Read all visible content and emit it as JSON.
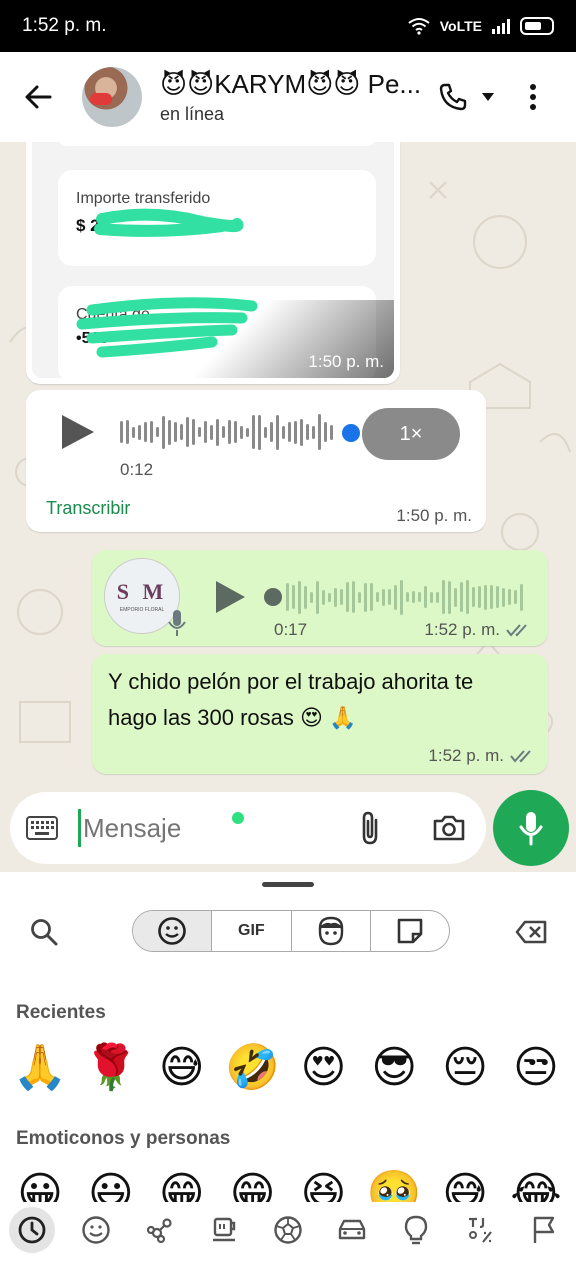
{
  "status_bar": {
    "time": "1:52 p. m.",
    "network": "VoLTE"
  },
  "header": {
    "name": "😈😈KARYM😈😈 Pe...",
    "status": "en línea"
  },
  "messages": {
    "transfer": {
      "field1_label": "Importe transferido",
      "field1_value": "$ 2,",
      "field2_label": "Cuenta de",
      "field2_value": "•518",
      "time": "1:50 p. m."
    },
    "audio_in": {
      "speed": "1×",
      "duration": "0:12",
      "transcribe": "Transcribir",
      "time": "1:50 p. m."
    },
    "audio_out": {
      "avatar_text": "S M",
      "avatar_sub": "EMPORIO FLORAL",
      "duration": "0:17",
      "time": "1:52 p. m."
    },
    "text_out": {
      "text": "Y chido pelón por el trabajo ahorita te hago las 300 rosas 😍 🙏",
      "time": "1:52 p. m."
    }
  },
  "input": {
    "placeholder": "Mensaje"
  },
  "emoji_panel": {
    "tabs": {
      "gif": "GIF"
    },
    "recent_label": "Recientes",
    "recent": [
      "🙏",
      "🌹",
      "😅",
      "🤣",
      "😍",
      "😎",
      "😔",
      "😒"
    ],
    "people_label": "Emoticonos y personas",
    "people": [
      "😀",
      "😃",
      "😁",
      "😁",
      "😆",
      "🥹",
      "😅",
      "😂"
    ]
  },
  "colors": {
    "accent": "#1fa855",
    "outgoing": "#dcf8c6",
    "incoming": "#ffffff",
    "highlight": "#33e0a3"
  }
}
